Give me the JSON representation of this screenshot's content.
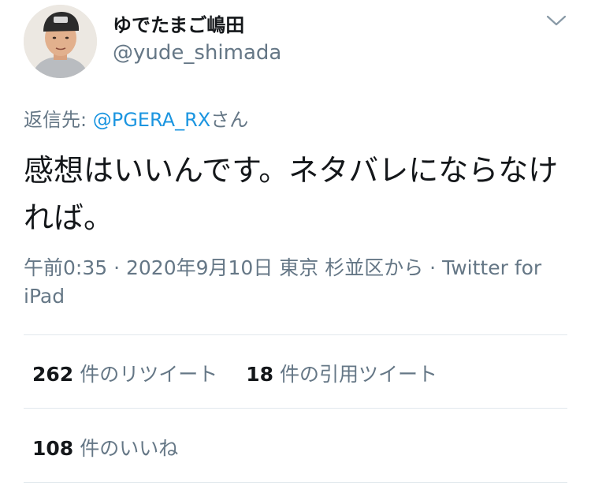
{
  "user": {
    "display_name": "ゆでたまご嶋田",
    "handle": "@yude_shimada"
  },
  "reply": {
    "prefix": "返信先: ",
    "target": "@PGERA_RX",
    "suffix": "さん"
  },
  "tweet": {
    "text": "感想はいいんです。ネタバレにならなければ。"
  },
  "meta": {
    "time": "午前0:35",
    "sep1": " · ",
    "date": "2020年9月10日",
    "location": " 東京 杉並区から",
    "sep2": " · ",
    "source": "Twitter for iPad"
  },
  "stats": {
    "retweets_count": "262",
    "retweets_label": "件のリツイート",
    "quotes_count": "18",
    "quotes_label": "件の引用ツイート",
    "likes_count": "108",
    "likes_label": "件のいいね"
  },
  "icons": {
    "more": "chevron-down-icon"
  }
}
